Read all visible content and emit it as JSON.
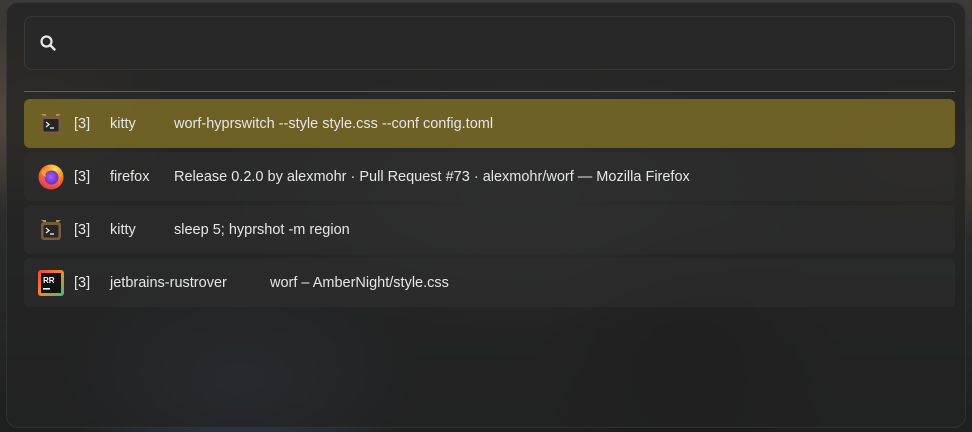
{
  "search": {
    "placeholder": "",
    "value": ""
  },
  "colors": {
    "selected_row": "#7a6a27",
    "divider": "#6d6228",
    "window_bg": "#222222"
  },
  "results": [
    {
      "icon": "kitty-terminal-icon",
      "workspace": "[3]",
      "app": "kitty",
      "title": "worf-hyprswitch --style style.css --conf config.toml",
      "selected": true
    },
    {
      "icon": "firefox-icon",
      "workspace": "[3]",
      "app": "firefox",
      "title": "Release 0.2.0 by alexmohr · Pull Request #73 · alexmohr/worf — Mozilla Firefox",
      "selected": false
    },
    {
      "icon": "kitty-terminal-icon",
      "workspace": "[3]",
      "app": "kitty",
      "title": "sleep 5; hyprshot -m region",
      "selected": false
    },
    {
      "icon": "rustrover-icon",
      "workspace": "[3]",
      "app": "jetbrains-rustrover",
      "title": "worf – AmberNight/style.css",
      "selected": false
    }
  ]
}
